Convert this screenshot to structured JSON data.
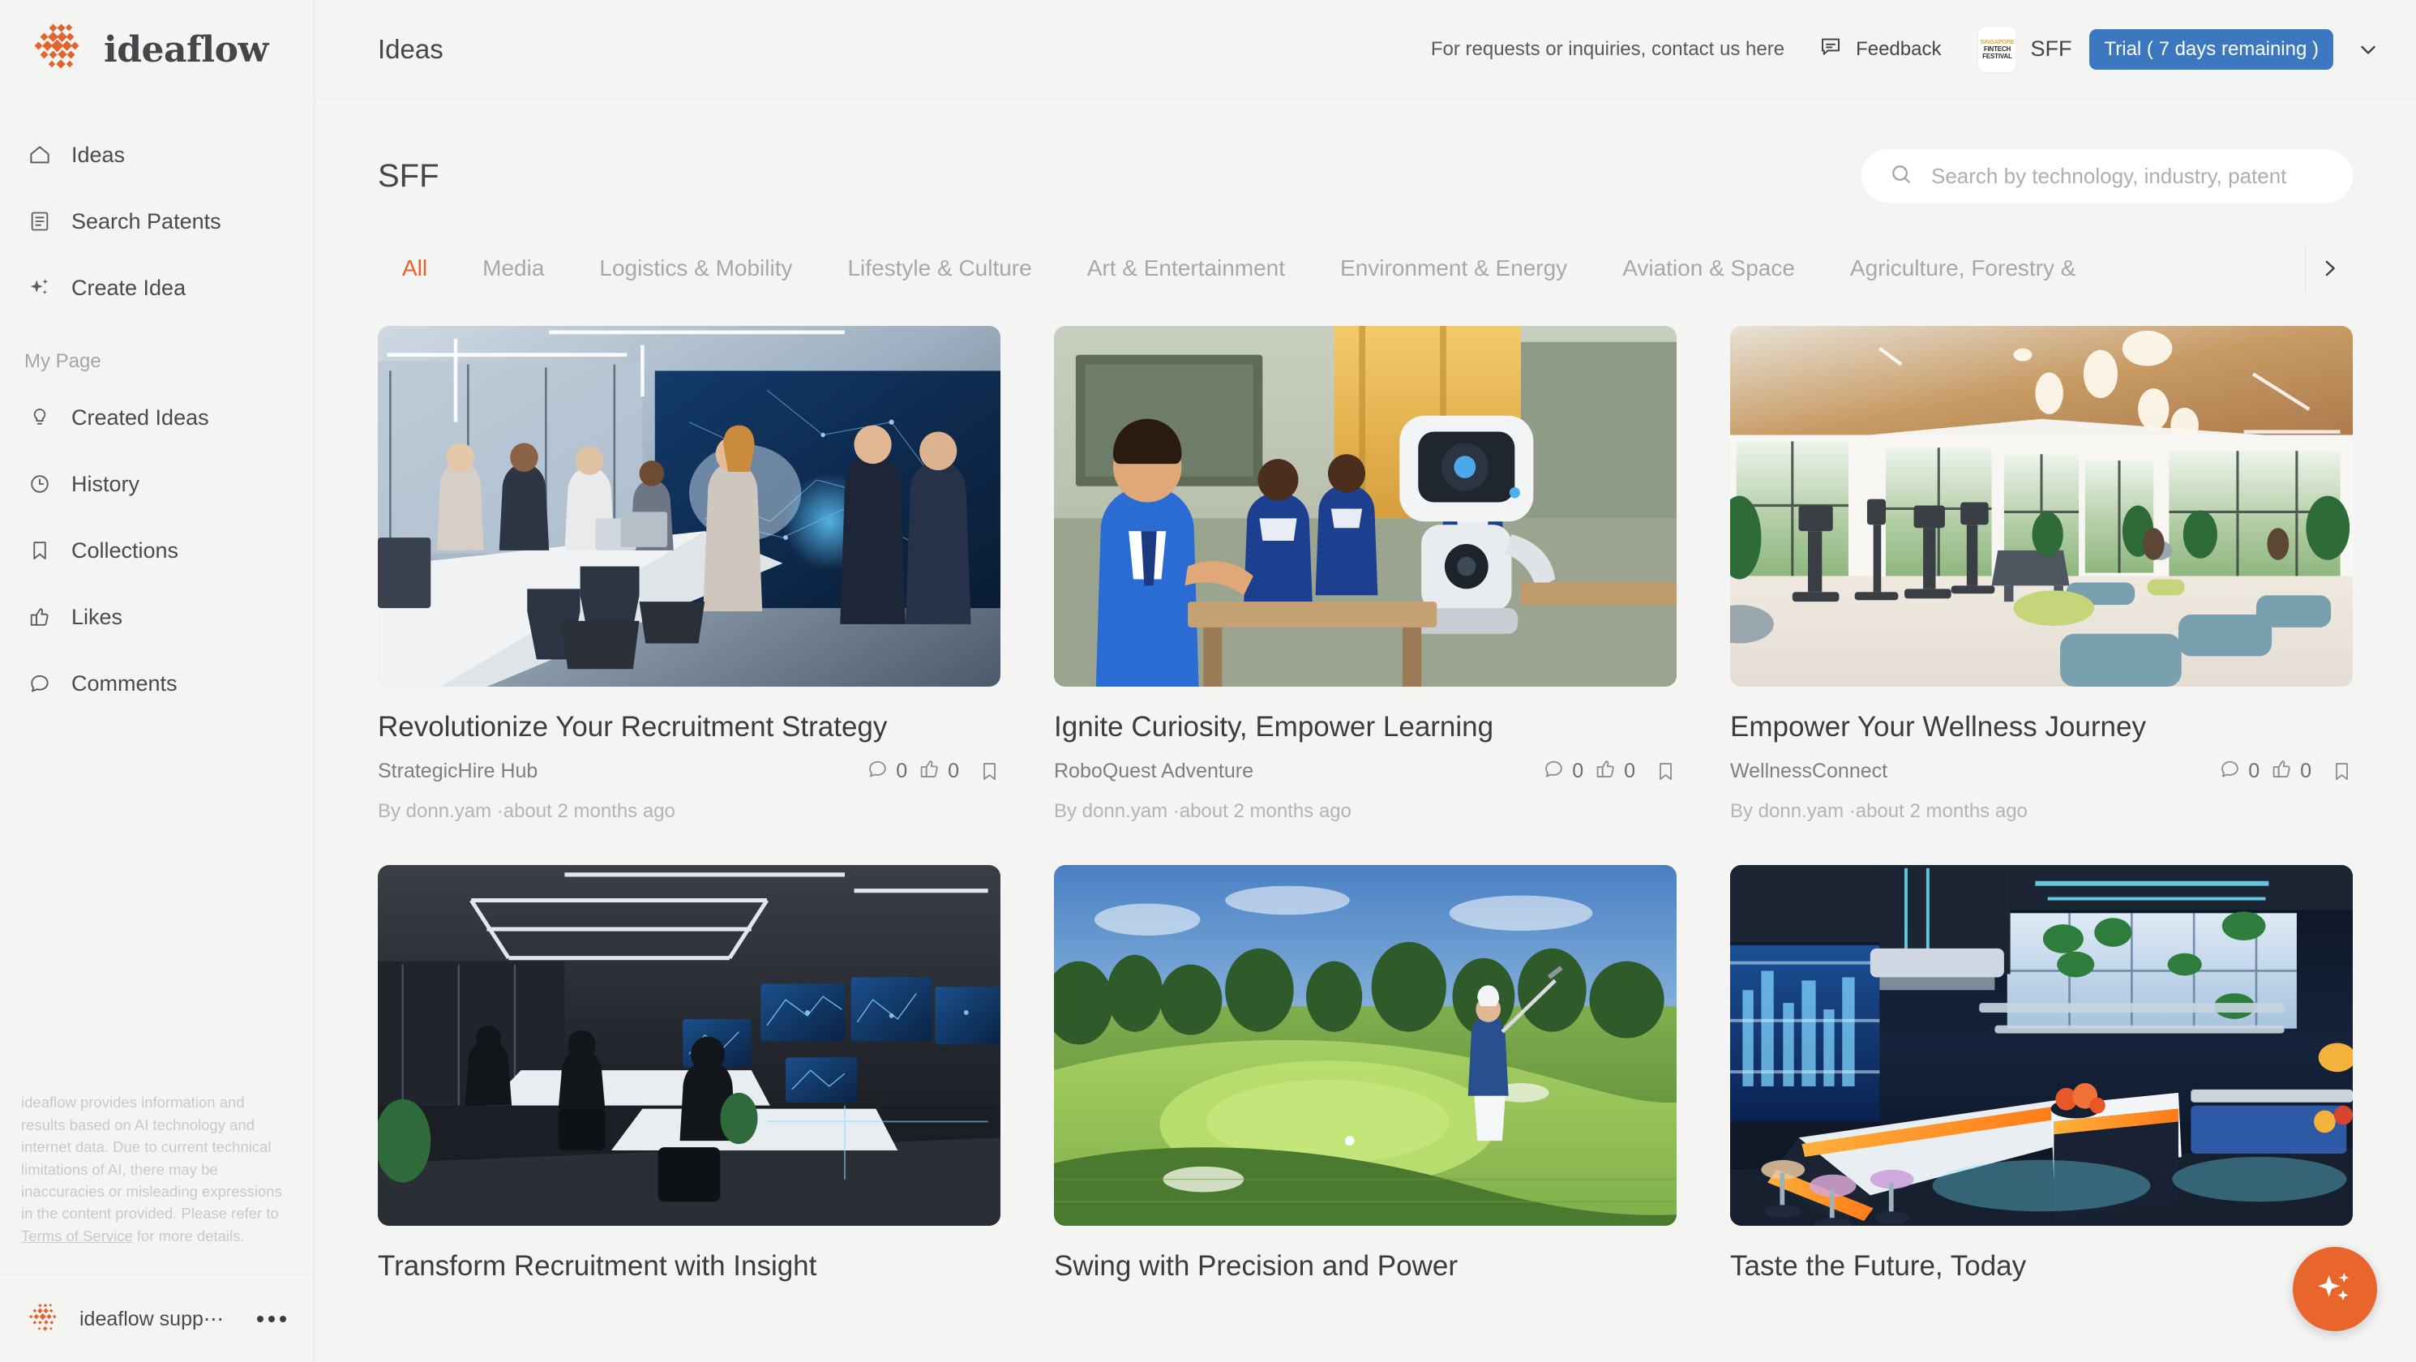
{
  "brand": {
    "name": "ideaflow",
    "logo_icon": "ideaflow-dot-logo"
  },
  "sidebar": {
    "nav": [
      {
        "label": "Ideas",
        "icon": "home-icon"
      },
      {
        "label": "Search Patents",
        "icon": "document-text-icon"
      },
      {
        "label": "Create Idea",
        "icon": "sparkles-icon"
      }
    ],
    "my_page": {
      "section_label": "My Page",
      "items": [
        {
          "label": "Created Ideas",
          "icon": "lightbulb-icon"
        },
        {
          "label": "History",
          "icon": "clock-icon"
        },
        {
          "label": "Collections",
          "icon": "bookmark-icon"
        },
        {
          "label": "Likes",
          "icon": "thumbs-up-icon"
        },
        {
          "label": "Comments",
          "icon": "comment-bubble-icon"
        }
      ]
    },
    "disclaimer": {
      "text_before": "ideaflow provides information and results based on AI technology and internet data. Due to current technical limitations of AI, there may be inaccuracies or misleading expressions in the content provided. Please refer to ",
      "link_text": "Terms of Service",
      "text_after": " for more details."
    },
    "user": {
      "name": "ideaflow supp⋯",
      "avatar_icon": "ideaflow-dot-logo",
      "menu_icon": "kebab-menu-icon"
    }
  },
  "topbar": {
    "page_label": "Ideas",
    "contact_note": "For requests or inquiries, contact us here",
    "feedback_label": "Feedback",
    "feedback_icon": "feedback-bubble-icon",
    "org_badge": {
      "line1": "SINGAPORE",
      "line2": "FINTECH",
      "line3": "FESTIVAL"
    },
    "org_name": "SFF",
    "trial_label": "Trial ( 7 days remaining )",
    "trial_color": "#3b78bf",
    "chevron_icon": "chevron-down-icon"
  },
  "content": {
    "title": "SFF",
    "search": {
      "placeholder": "Search by technology, industry, patent",
      "value": "",
      "icon": "search-icon"
    },
    "tabs": [
      {
        "label": "All",
        "active": true
      },
      {
        "label": "Media",
        "active": false
      },
      {
        "label": "Logistics & Mobility",
        "active": false
      },
      {
        "label": "Lifestyle & Culture",
        "active": false
      },
      {
        "label": "Art & Entertainment",
        "active": false
      },
      {
        "label": "Environment & Energy",
        "active": false
      },
      {
        "label": "Aviation & Space",
        "active": false
      },
      {
        "label": "Agriculture, Forestry &",
        "active": false
      }
    ],
    "tab_next_icon": "chevron-right-icon",
    "active_tab_color": "#e8602c",
    "cards": [
      {
        "title": "Revolutionize Your Recruitment Strategy",
        "subtitle": "StrategicHire Hub",
        "comments": "0",
        "likes": "0",
        "meta": "By donn.yam  ·about 2 months ago",
        "image_alt": "corporate-office-holographic-display"
      },
      {
        "title": "Ignite Curiosity, Empower Learning",
        "subtitle": "RoboQuest Adventure",
        "comments": "0",
        "likes": "0",
        "meta": "By donn.yam  ·about 2 months ago",
        "image_alt": "child-with-classroom-robot"
      },
      {
        "title": "Empower Your Wellness Journey",
        "subtitle": "WellnessConnect",
        "comments": "0",
        "likes": "0",
        "meta": "By donn.yam  ·about 2 months ago",
        "image_alt": "bright-modern-gym-lounge"
      },
      {
        "title": "Transform Recruitment with Insight",
        "subtitle": "",
        "comments": "",
        "likes": "",
        "meta": "",
        "image_alt": "dark-office-with-data-screens"
      },
      {
        "title": "Swing with Precision and Power",
        "subtitle": "",
        "comments": "",
        "likes": "",
        "meta": "",
        "image_alt": "golf-course-with-player"
      },
      {
        "title": "Taste the Future, Today",
        "subtitle": "",
        "comments": "",
        "likes": "",
        "meta": "",
        "image_alt": "neon-futuristic-kitchen"
      }
    ],
    "fab_icon": "sparkles-icon"
  }
}
